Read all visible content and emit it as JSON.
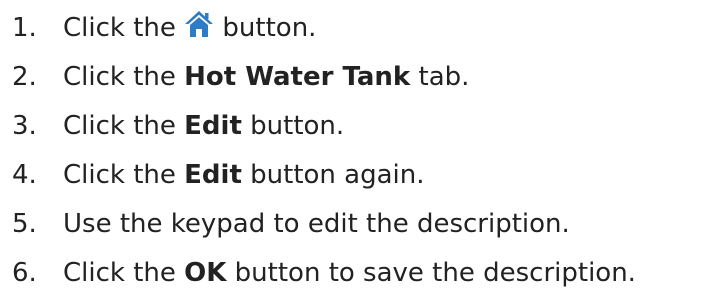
{
  "steps": [
    {
      "num": "1.",
      "before": "Click the ",
      "after": " button.",
      "icon": "home-icon",
      "icon_color": "#2e7cc6"
    },
    {
      "num": "2.",
      "before": "Click the ",
      "bold": "Hot Water Tank",
      "after": " tab."
    },
    {
      "num": "3.",
      "before": "Click the ",
      "bold": "Edit",
      "after": " button."
    },
    {
      "num": "4.",
      "before": "Click the ",
      "bold": "Edit",
      "after": " button again."
    },
    {
      "num": "5.",
      "text": "Use the keypad to edit the description."
    },
    {
      "num": "6.",
      "before": "Click the ",
      "bold": "OK",
      "after": " button to save the description."
    }
  ]
}
